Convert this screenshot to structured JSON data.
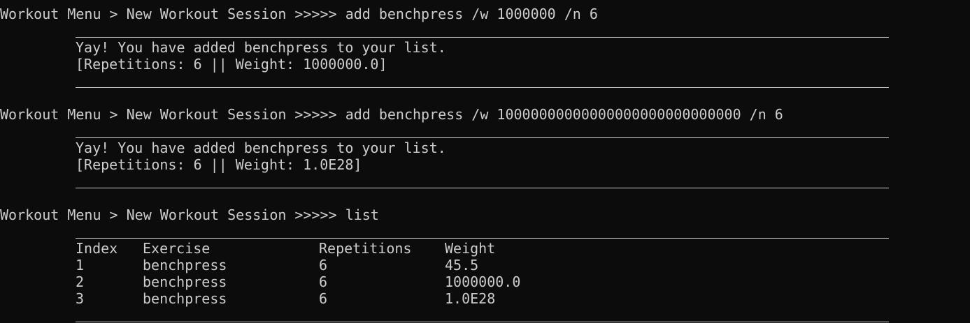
{
  "prompt": "Workout Menu > New Workout Session >>>>> ",
  "commands": [
    "add benchpress /w 1000000 /n 6",
    "add benchpress /w 10000000000000000000000000000 /n 6",
    "list"
  ],
  "responses": [
    {
      "message": "Yay! You have added benchpress to your list.",
      "detail": "[Repetitions: 6 || Weight: 1000000.0]"
    },
    {
      "message": "Yay! You have added benchpress to your list.",
      "detail": "[Repetitions: 6 || Weight: 1.0E28]"
    }
  ],
  "table": {
    "headers": [
      "Index",
      "Exercise",
      "Repetitions",
      "Weight"
    ],
    "rows": [
      [
        "1",
        "benchpress",
        "6",
        "45.5"
      ],
      [
        "2",
        "benchpress",
        "6",
        "1000000.0"
      ],
      [
        "3",
        "benchpress",
        "6",
        "1.0E28"
      ]
    ]
  }
}
